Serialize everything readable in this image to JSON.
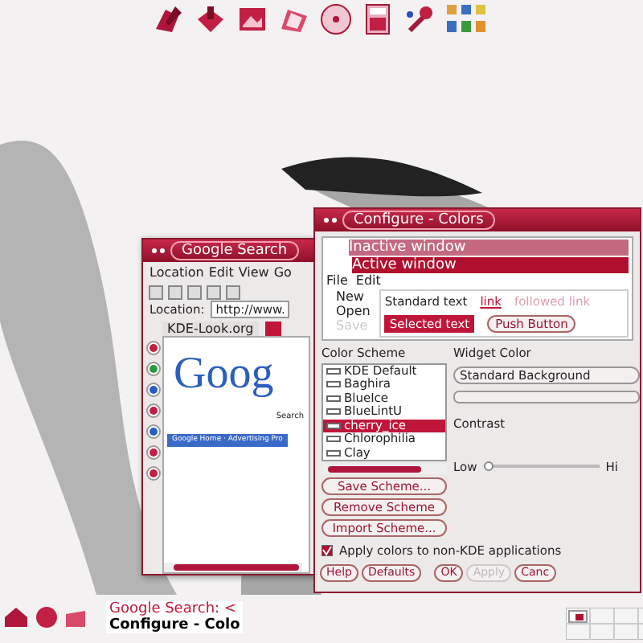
{
  "browser": {
    "title": "Google Search",
    "menu": [
      "Location",
      "Edit",
      "View",
      "Go"
    ],
    "location_label": "Location:",
    "url": "http://www.",
    "tabs": [
      {
        "label": "KDE-Look.org",
        "selected": false
      },
      {
        "selected": true
      }
    ],
    "page": {
      "logo": "Goog",
      "search_hint": "Search",
      "footer": "Google Home · Advertising Pro"
    }
  },
  "dialog": {
    "title": "Configure - Colors",
    "preview": {
      "inactive_title": "Inactive window",
      "active_title": "Active window",
      "menu": [
        "File",
        "Edit"
      ],
      "menu_items": [
        {
          "label": "New",
          "disabled": false
        },
        {
          "label": "Open",
          "disabled": false
        },
        {
          "label": "Save",
          "disabled": true
        }
      ],
      "standard_text": "Standard text",
      "link": "link",
      "followed_link": "followed link",
      "selected_text": "Selected text",
      "push_button": "Push Button"
    },
    "scheme_group": "Color Scheme",
    "schemes": [
      {
        "label": "KDE Default",
        "selected": false
      },
      {
        "label": "Baghira",
        "selected": false
      },
      {
        "label": "BlueIce",
        "selected": false
      },
      {
        "label": "BlueLintU",
        "selected": false
      },
      {
        "label": "cherry_ice",
        "selected": true
      },
      {
        "label": "Chlorophilia",
        "selected": false
      },
      {
        "label": "Clay",
        "selected": false
      }
    ],
    "scheme_buttons": [
      "Save Scheme...",
      "Remove Scheme",
      "Import Scheme..."
    ],
    "widget_group": "Widget Color",
    "widget_select": "Standard Background",
    "contrast_group": "Contrast",
    "low": "Low",
    "contrast": {
      "level": 0
    },
    "high": "Hi",
    "apply": {
      "label": "Apply colors to non-KDE applications",
      "checked": true
    },
    "buttons": [
      {
        "label": "Help",
        "disabled": false
      },
      {
        "label": "Defaults",
        "disabled": false
      },
      {
        "label": "OK",
        "disabled": false
      },
      {
        "label": "Apply",
        "disabled": true
      },
      {
        "label": "Canc",
        "disabled": false
      }
    ]
  },
  "taskbar": {
    "tasks": [
      {
        "label": "Google Search: <",
        "selected": false
      },
      {
        "label": "Configure - Colo",
        "selected": true
      }
    ]
  }
}
